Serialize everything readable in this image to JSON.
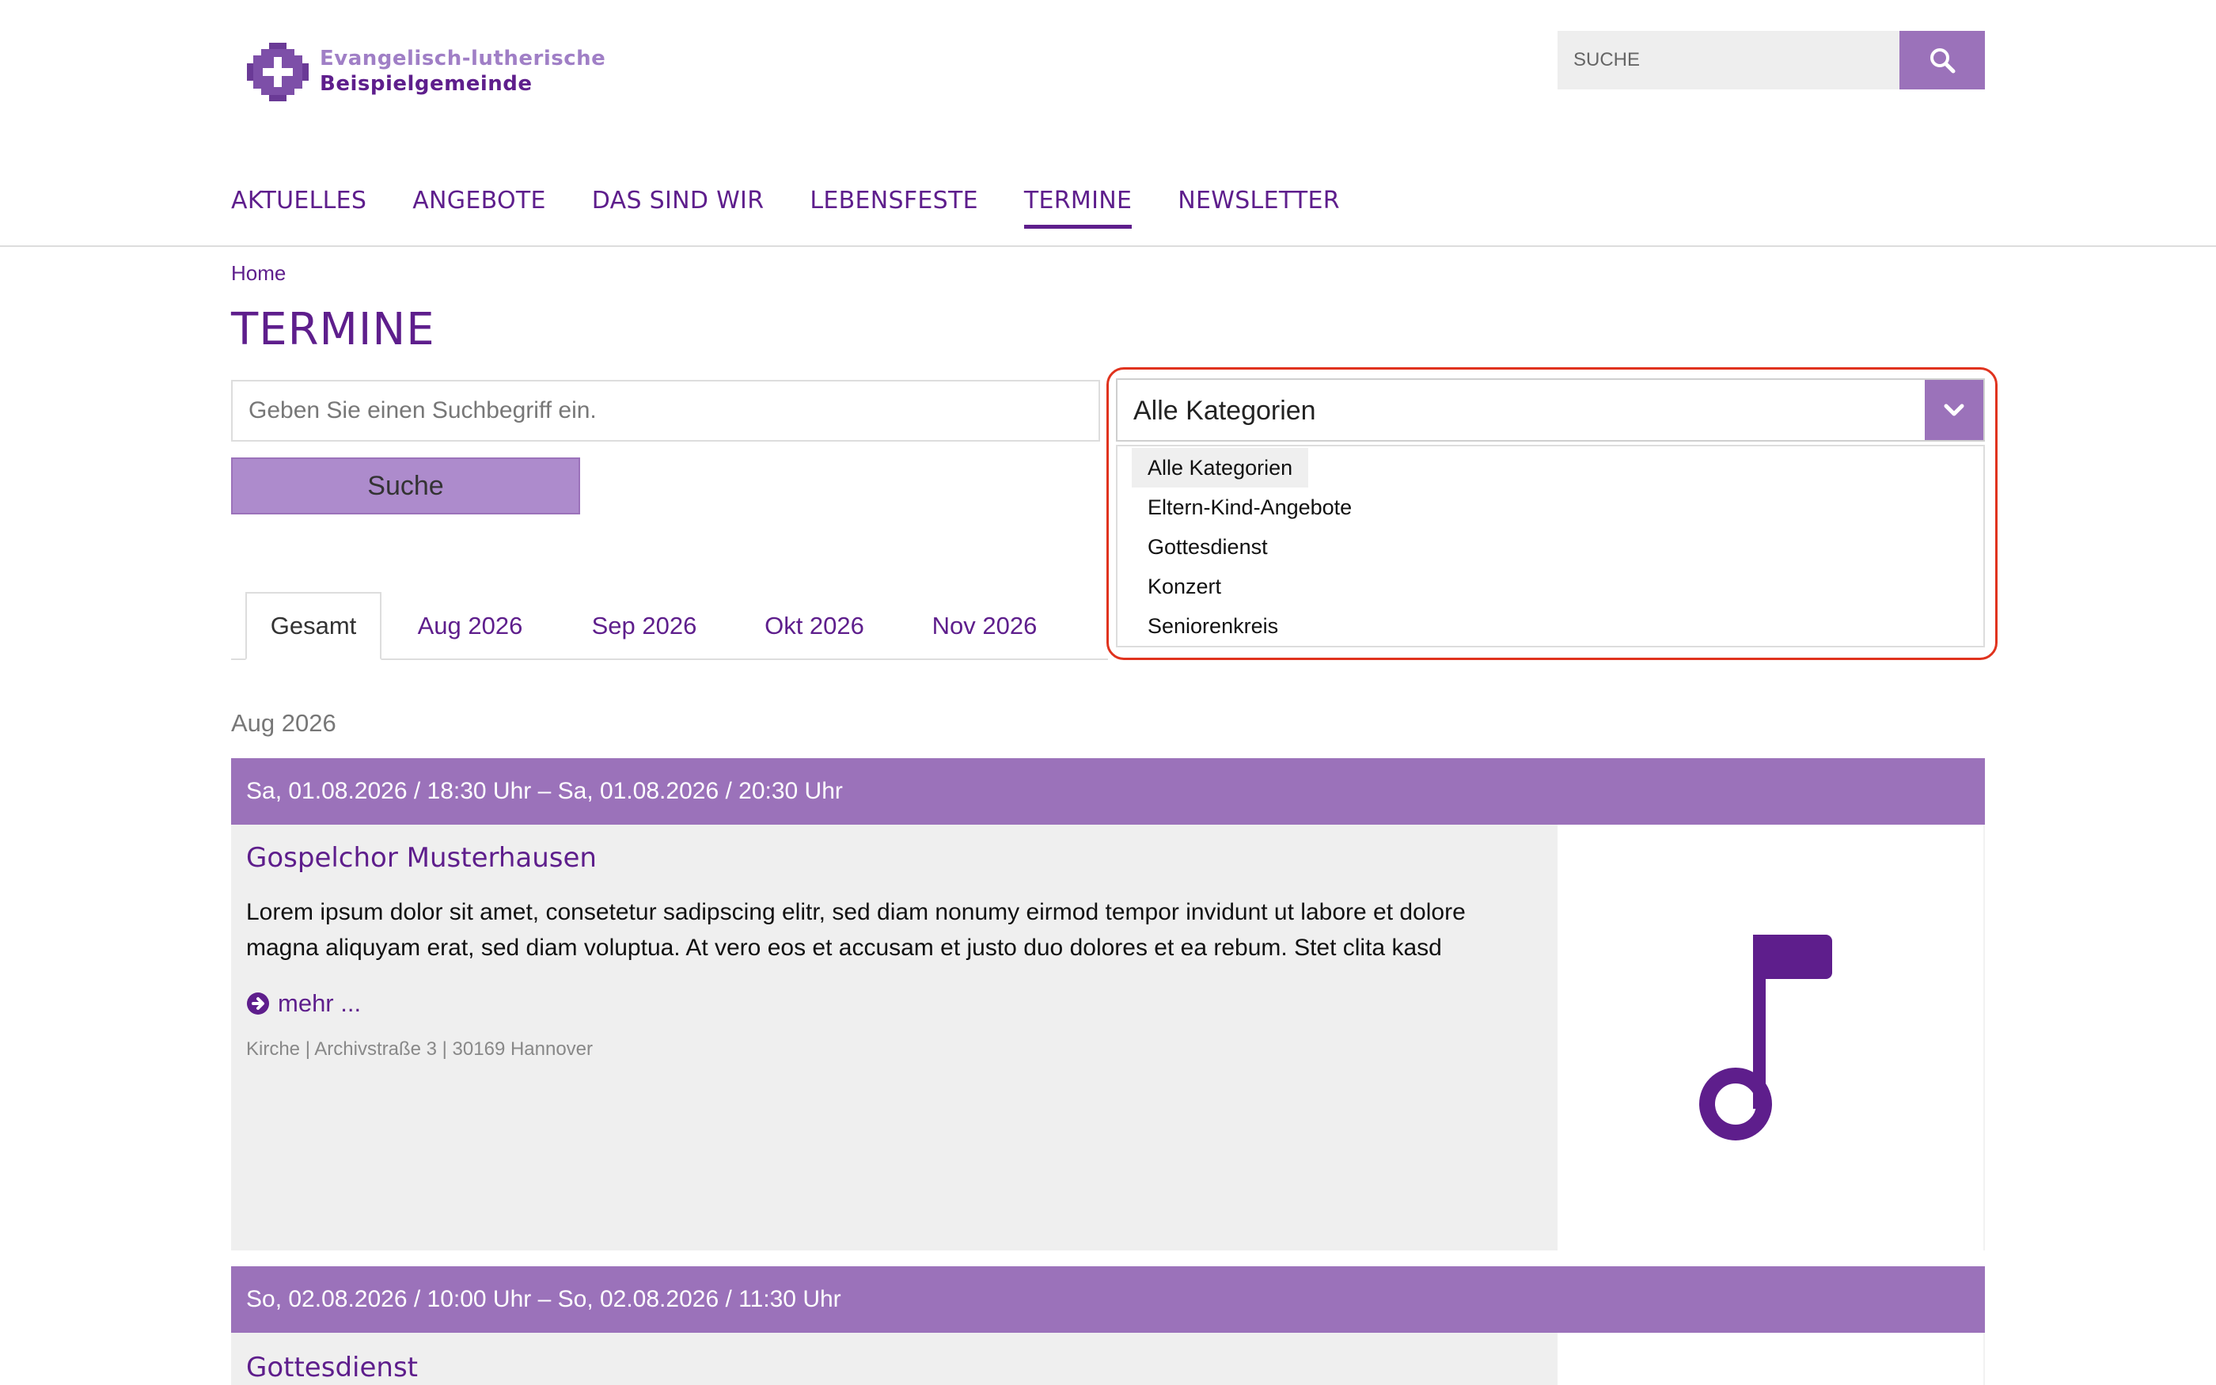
{
  "logo": {
    "line1": "Evangelisch-lutherische",
    "line2": "Beispielgemeinde"
  },
  "header": {
    "search_placeholder": "SUCHE"
  },
  "nav": {
    "items": [
      {
        "label": "AKTUELLES"
      },
      {
        "label": "ANGEBOTE"
      },
      {
        "label": "DAS SIND WIR"
      },
      {
        "label": "LEBENSFESTE"
      },
      {
        "label": "TERMINE",
        "active": true
      },
      {
        "label": "NEWSLETTER"
      }
    ]
  },
  "breadcrumb": "Home",
  "page_title": "TERMINE",
  "filter": {
    "search_placeholder": "Geben Sie einen Suchbegriff ein.",
    "search_button": "Suche",
    "category_selected": "Alle Kategorien",
    "category_options": [
      "Alle Kategorien",
      "Eltern-Kind-Angebote",
      "Gottesdienst",
      "Konzert",
      "Seniorenkreis"
    ]
  },
  "tabs": [
    {
      "label": "Gesamt",
      "active": true
    },
    {
      "label": "Aug 2026"
    },
    {
      "label": "Sep 2026"
    },
    {
      "label": "Okt 2026"
    },
    {
      "label": "Nov 2026"
    }
  ],
  "month_heading": "Aug 2026",
  "events": [
    {
      "datetime": "Sa, 01.08.2026 / 18:30 Uhr – Sa, 01.08.2026 / 20:30 Uhr",
      "title": "Gospelchor Musterhausen",
      "description_line1": "Lorem ipsum dolor sit amet, consetetur sadipscing elitr, sed diam nonumy eirmod tempor invidunt ut labore et dolore",
      "description_line2": "magna aliquyam erat, sed diam voluptua. At vero eos et accusam et justo duo dolores et ea rebum. Stet clita kasd",
      "more_label": "mehr ...",
      "location": "Kirche | Archivstraße 3 | 30169 Hannover",
      "image_icon": "music-note-icon"
    },
    {
      "datetime": "So, 02.08.2026 / 10:00 Uhr – So, 02.08.2026 / 11:30 Uhr",
      "title": "Gottesdienst"
    }
  ],
  "colors": {
    "primary": "#5e1e8c",
    "accent": "#9b72ba",
    "highlight": "#e0331e"
  }
}
